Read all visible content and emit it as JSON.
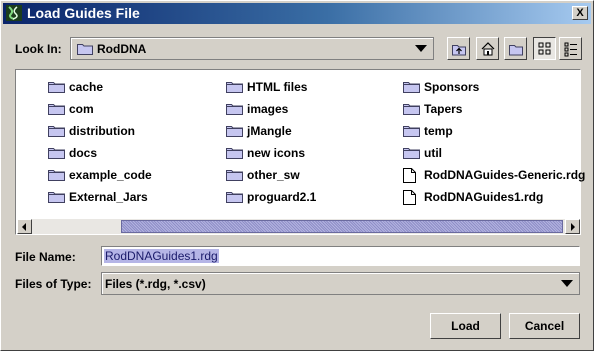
{
  "window": {
    "title": "Load Guides File",
    "close_label": "X"
  },
  "look_in": {
    "label": "Look In:",
    "value": "RodDNA"
  },
  "toolbar": {
    "buttons": [
      "up-one-level",
      "home",
      "new-folder",
      "list-view",
      "details-view"
    ],
    "active": "list-view"
  },
  "files": {
    "col1": [
      {
        "name": "cache",
        "type": "folder"
      },
      {
        "name": "com",
        "type": "folder"
      },
      {
        "name": "distribution",
        "type": "folder"
      },
      {
        "name": "docs",
        "type": "folder"
      },
      {
        "name": "example_code",
        "type": "folder"
      },
      {
        "name": "External_Jars",
        "type": "folder"
      }
    ],
    "col2": [
      {
        "name": "HTML files",
        "type": "folder"
      },
      {
        "name": "images",
        "type": "folder"
      },
      {
        "name": "jMangle",
        "type": "folder"
      },
      {
        "name": "new icons",
        "type": "folder"
      },
      {
        "name": "other_sw",
        "type": "folder"
      },
      {
        "name": "proguard2.1",
        "type": "folder"
      }
    ],
    "col3": [
      {
        "name": "Sponsors",
        "type": "folder"
      },
      {
        "name": "Tapers",
        "type": "folder"
      },
      {
        "name": "temp",
        "type": "folder"
      },
      {
        "name": "util",
        "type": "folder"
      },
      {
        "name": "RodDNAGuides-Generic.rdg",
        "type": "file"
      },
      {
        "name": "RodDNAGuides1.rdg",
        "type": "file"
      }
    ]
  },
  "file_name": {
    "label": "File Name:",
    "value": "RodDNAGuides1.rdg"
  },
  "file_type": {
    "label": "Files of Type:",
    "value": "Files (*.rdg, *.csv)"
  },
  "buttons": {
    "load": "Load",
    "cancel": "Cancel"
  },
  "colors": {
    "title_bar": "#0a246a",
    "folder": "#c6c6f0",
    "selection": "#b5b5e6"
  }
}
